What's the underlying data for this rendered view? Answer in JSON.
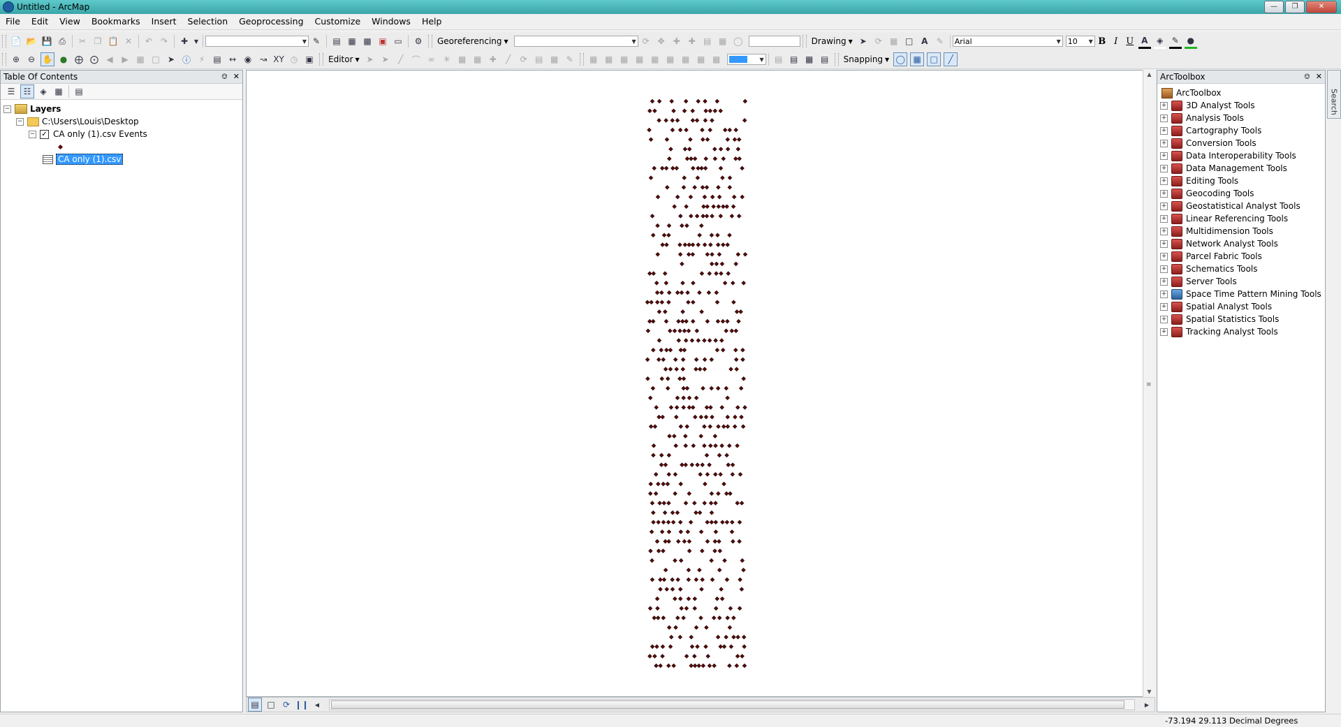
{
  "window": {
    "title": "Untitled - ArcMap"
  },
  "menu": [
    "File",
    "Edit",
    "View",
    "Bookmarks",
    "Insert",
    "Selection",
    "Geoprocessing",
    "Customize",
    "Windows",
    "Help"
  ],
  "toolbar": {
    "georeferencing_label": "Georeferencing",
    "drawing_label": "Drawing",
    "font_name": "Arial",
    "font_size": "10",
    "bold_label": "B",
    "italic_label": "I",
    "underline_label": "U",
    "editor_label": "Editor",
    "snapping_label": "Snapping"
  },
  "toc": {
    "title": "Table Of Contents",
    "layers_label": "Layers",
    "folder_path": "C:\\Users\\Louis\\Desktop",
    "events_layer": "CA only (1).csv Events",
    "events_layer_checked": true,
    "table_name": "CA only (1).csv"
  },
  "toolbox": {
    "title": "ArcToolbox",
    "root_label": "ArcToolbox",
    "items": [
      "3D Analyst Tools",
      "Analysis Tools",
      "Cartography Tools",
      "Conversion Tools",
      "Data Interoperability Tools",
      "Data Management Tools",
      "Editing Tools",
      "Geocoding Tools",
      "Geostatistical Analyst Tools",
      "Linear Referencing Tools",
      "Multidimension Tools",
      "Network Analyst Tools",
      "Parcel Fabric Tools",
      "Schematics Tools",
      "Server Tools",
      "Space Time Pattern Mining Tools",
      "Spatial Analyst Tools",
      "Spatial Statistics Tools",
      "Tracking Analyst Tools"
    ],
    "search_tab": "Search"
  },
  "map": {
    "point_color": "#5a0b0b",
    "point_outline": "#1a0000"
  },
  "status": {
    "coords": "-73.194  29.113 Decimal Degrees"
  }
}
